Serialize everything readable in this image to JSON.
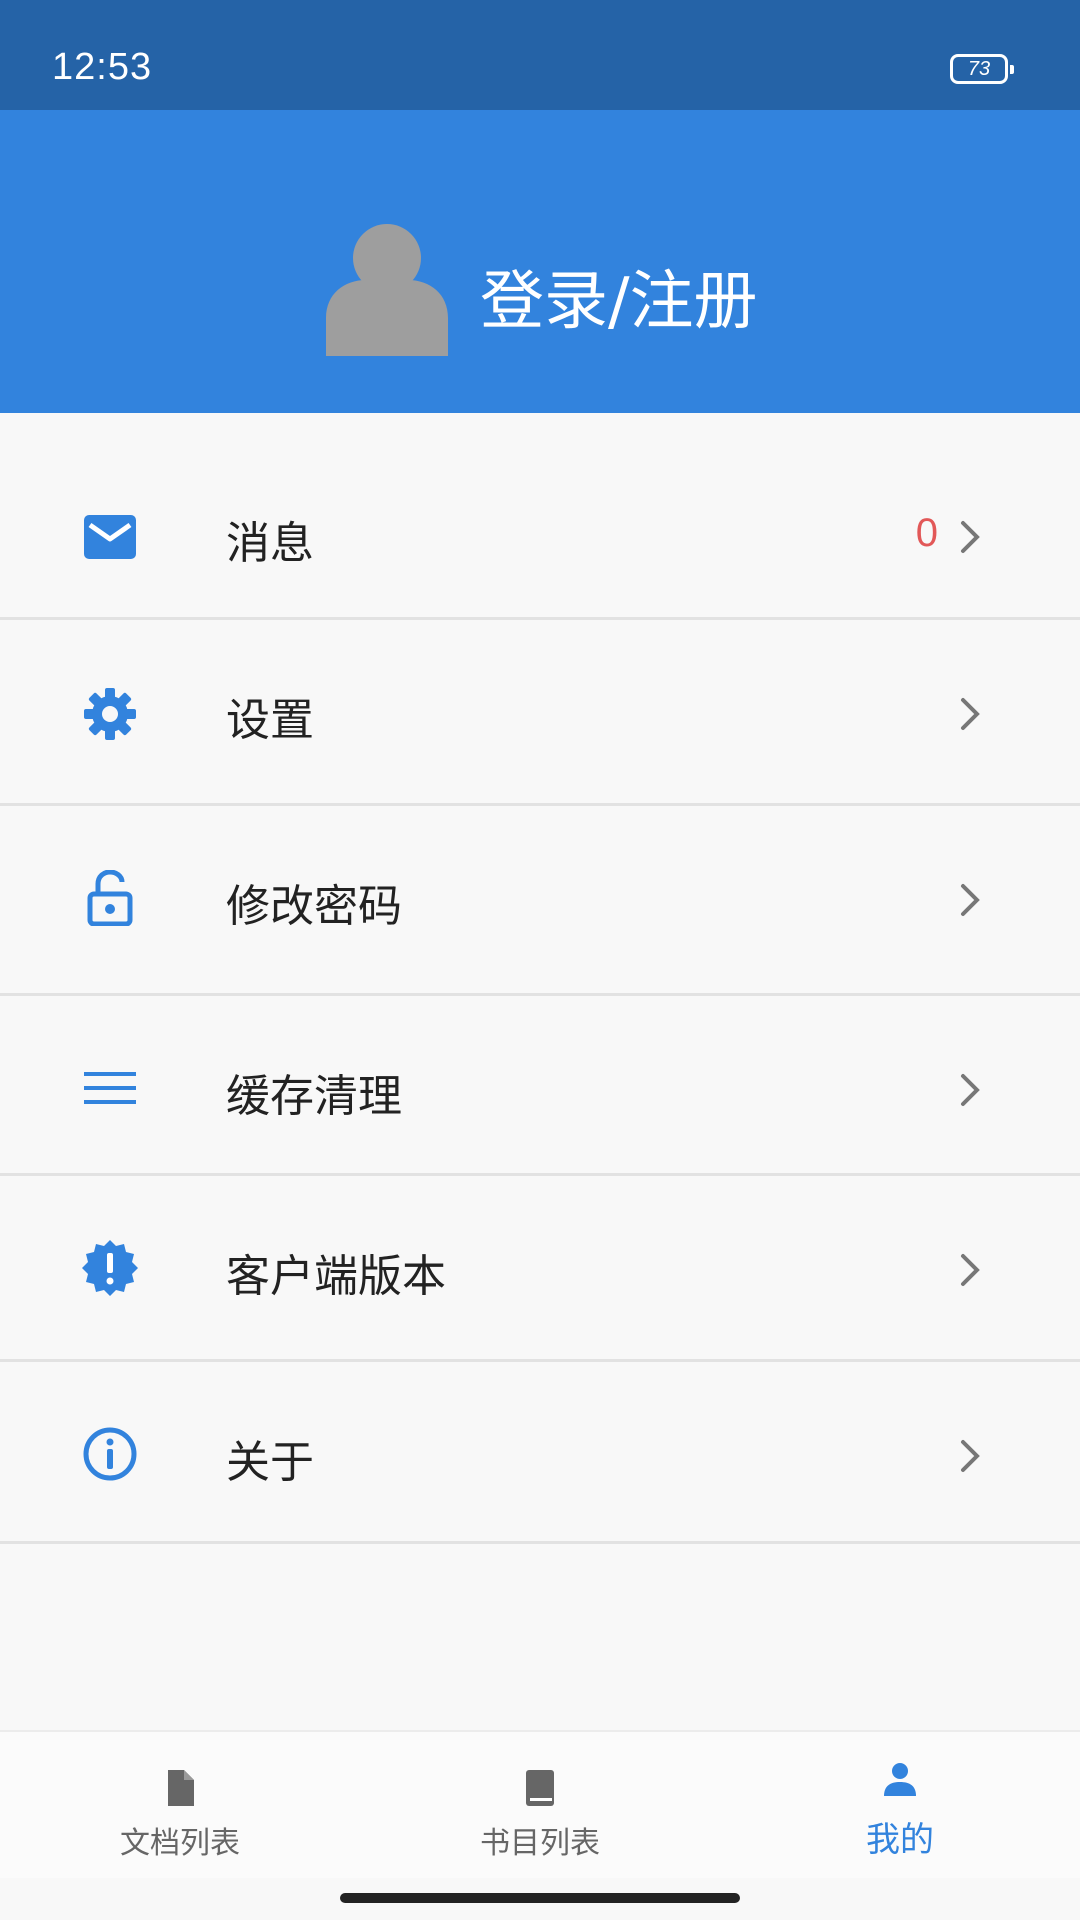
{
  "status_bar": {
    "time": "12:53",
    "battery": "73"
  },
  "header": {
    "login_label": "登录/注册",
    "avatar_icon": "user-avatar-icon"
  },
  "menu": {
    "items": [
      {
        "label": "消息",
        "icon": "mail-icon",
        "badge": "0"
      },
      {
        "label": "设置",
        "icon": "gear-icon"
      },
      {
        "label": "修改密码",
        "icon": "lock-icon"
      },
      {
        "label": "缓存清理",
        "icon": "menu-lines-icon"
      },
      {
        "label": "客户端版本",
        "icon": "alert-badge-icon"
      },
      {
        "label": "关于",
        "icon": "info-icon"
      }
    ]
  },
  "tabbar": {
    "tabs": [
      {
        "label": "文档列表",
        "icon": "document-icon",
        "active": false
      },
      {
        "label": "书目列表",
        "icon": "book-icon",
        "active": false
      },
      {
        "label": "我的",
        "icon": "person-icon",
        "active": true
      }
    ]
  },
  "colors": {
    "header_blue": "#3283dd",
    "status_blue": "#2563a7",
    "icon_blue": "#3283dd",
    "badge_red": "#e25858",
    "avatar_gray": "#9e9e9e"
  }
}
